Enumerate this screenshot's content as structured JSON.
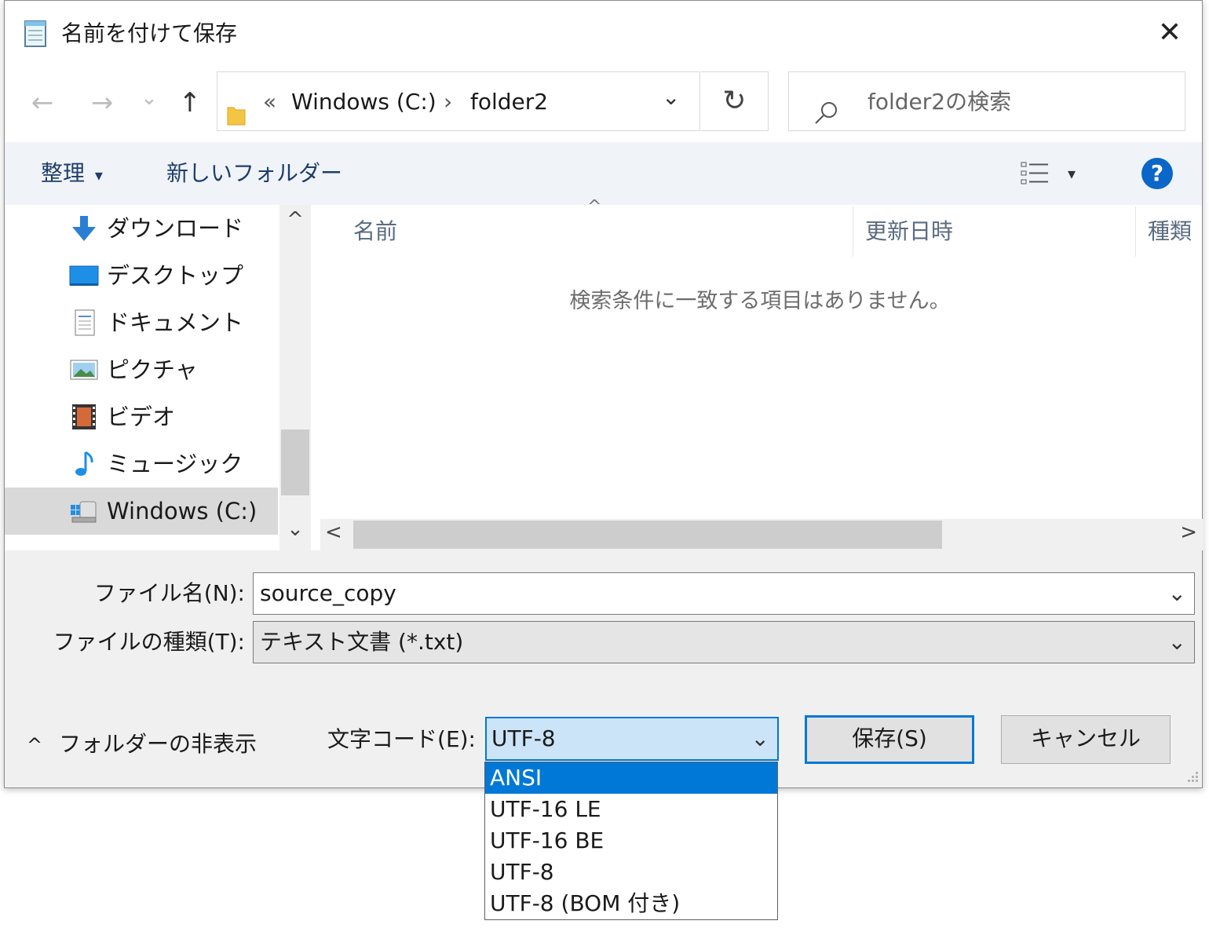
{
  "window": {
    "title": "名前を付けて保存",
    "close_glyph": "✕"
  },
  "nav": {
    "back_glyph": "←",
    "forward_glyph": "→",
    "recent_glyph": "⌄",
    "up_glyph": "↑",
    "address": {
      "overflow_glyph": "«",
      "segments": [
        "Windows (C:)",
        "folder2"
      ],
      "separator_glyph": "›",
      "dropdown_glyph": "⌄"
    },
    "refresh_glyph": "↻",
    "search_placeholder": "folder2の検索"
  },
  "toolbar": {
    "organize_label": "整理",
    "organize_caret": "▾",
    "new_folder_label": "新しいフォルダー",
    "view_caret": "▾",
    "help_glyph": "?"
  },
  "navpane": {
    "scroll_up_glyph": "^",
    "scroll_down_glyph": "⌄",
    "items": [
      {
        "label": "ダウンロード",
        "icon": "download-icon"
      },
      {
        "label": "デスクトップ",
        "icon": "desktop-icon"
      },
      {
        "label": "ドキュメント",
        "icon": "documents-icon"
      },
      {
        "label": "ピクチャ",
        "icon": "pictures-icon"
      },
      {
        "label": "ビデオ",
        "icon": "videos-icon"
      },
      {
        "label": "ミュージック",
        "icon": "music-icon"
      },
      {
        "label": "Windows (C:)",
        "icon": "drive-icon",
        "selected": true
      }
    ]
  },
  "filelist": {
    "sort_glyph": "^",
    "columns": [
      "名前",
      "更新日時",
      "種類"
    ],
    "empty_message": "検索条件に一致する項目はありません。",
    "scroll_left_glyph": "<",
    "scroll_right_glyph": ">"
  },
  "form": {
    "filename_label": "ファイル名(N):",
    "filename_value": "source_copy",
    "filetype_label": "ファイルの種類(T):",
    "filetype_value": "テキスト文書 (*.txt)",
    "combo_chevron": "⌄",
    "hide_folders_glyph": "^",
    "hide_folders_label": "フォルダーの非表示",
    "encoding_label": "文字コード(E):",
    "encoding_value": "UTF-8",
    "save_label": "保存(S)",
    "cancel_label": "キャンセル"
  },
  "encoding_dropdown": {
    "options": [
      "ANSI",
      "UTF-16 LE",
      "UTF-16 BE",
      "UTF-8",
      "UTF-8 (BOM 付き)"
    ],
    "highlighted_index": 0
  },
  "colors": {
    "accent": "#0078d7",
    "toolbar_bg": "#f0f4f9",
    "panel_bg": "#f0f0f0"
  }
}
